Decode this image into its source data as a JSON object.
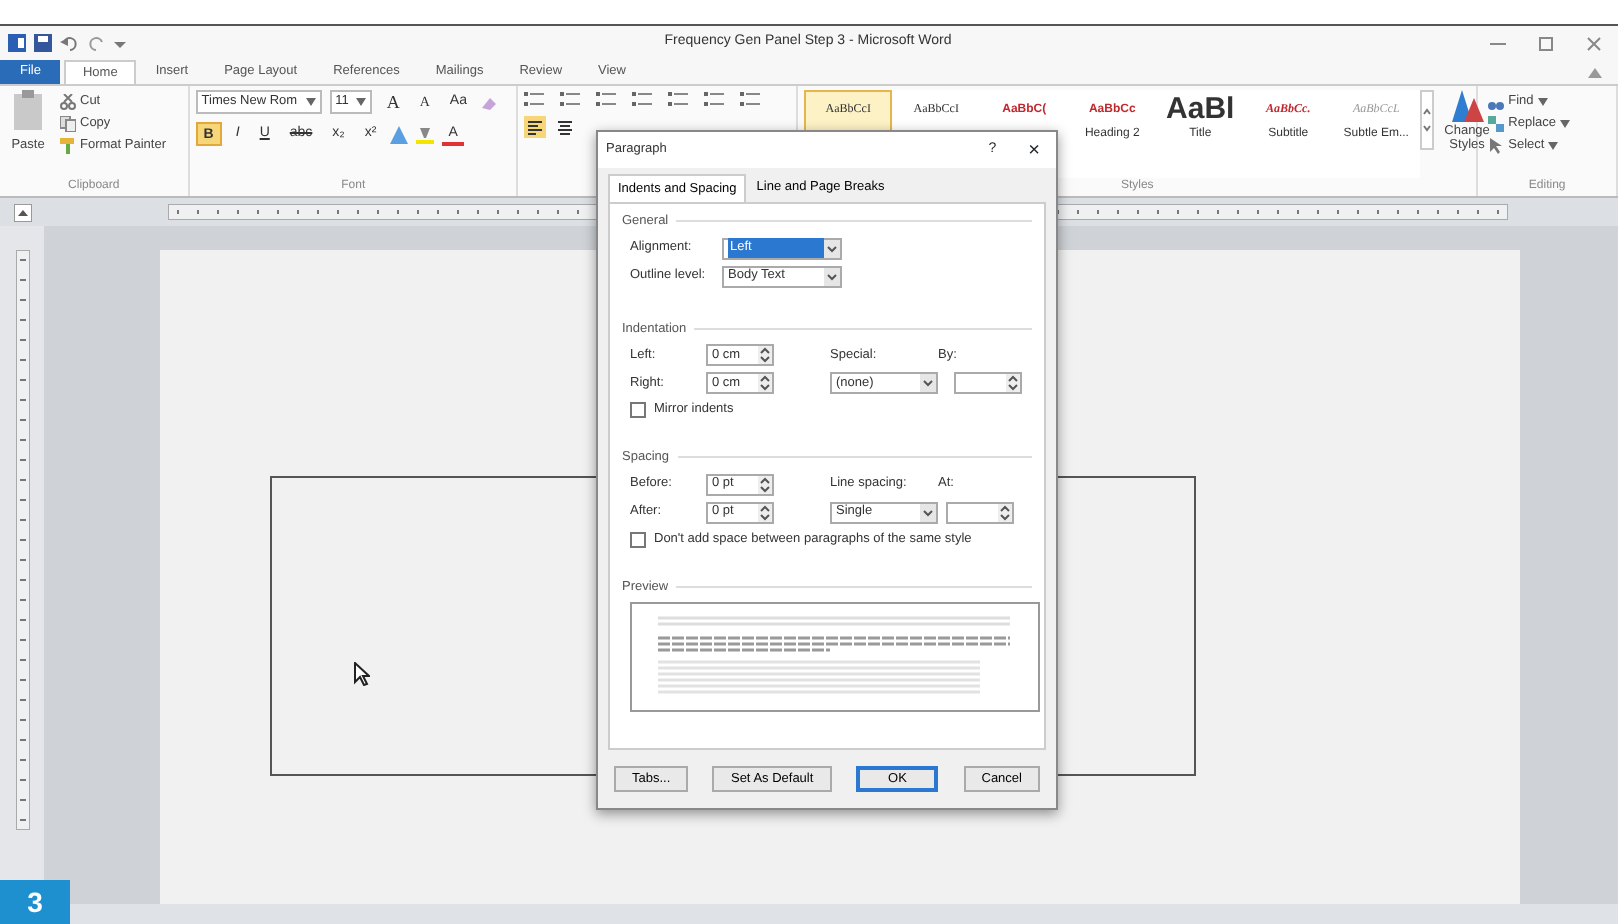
{
  "title_bar": {
    "title": "Frequency Gen Panel Step 3 - Microsoft Word"
  },
  "ribbon_tabs": [
    {
      "label": "File",
      "kind": "file",
      "selected": false
    },
    {
      "label": "Home",
      "kind": "tab",
      "selected": true
    },
    {
      "label": "Insert",
      "kind": "tab",
      "selected": false
    },
    {
      "label": "Page Layout",
      "kind": "tab",
      "selected": false
    },
    {
      "label": "References",
      "kind": "tab",
      "selected": false
    },
    {
      "label": "Mailings",
      "kind": "tab",
      "selected": false
    },
    {
      "label": "Review",
      "kind": "tab",
      "selected": false
    },
    {
      "label": "View",
      "kind": "tab",
      "selected": false
    }
  ],
  "clipboard": {
    "paste": "Paste",
    "items": [
      "Cut",
      "Copy",
      "Format Painter"
    ],
    "group_label": "Clipboard"
  },
  "font": {
    "name": "Times New Rom",
    "size": "11",
    "tools": [
      "A",
      "A",
      "Aa"
    ],
    "format_buttons": [
      {
        "label": "B",
        "kind": "bold",
        "selected": true
      },
      {
        "label": "I",
        "kind": "italic",
        "selected": false
      },
      {
        "label": "U",
        "kind": "underline",
        "selected": false
      },
      {
        "label": "abc",
        "kind": "strike",
        "selected": false
      },
      {
        "label": "x₂",
        "kind": "plain",
        "selected": false
      },
      {
        "label": "x²",
        "kind": "plain",
        "selected": false
      },
      {
        "label": "A",
        "kind": "color",
        "selected": false
      }
    ],
    "group_label": "Font"
  },
  "paragraph": {
    "align_left_selected": true
  },
  "styles": {
    "gallery": [
      {
        "sample": "AaBbCcI",
        "kind": "normal",
        "selected": true
      },
      {
        "sample": "AaBbCcI",
        "kind": "normal",
        "selected": false
      },
      {
        "sample": "AaBbC(",
        "kind": "heading",
        "selected": false
      },
      {
        "sample": "AaBbCc",
        "kind": "heading",
        "selected": false,
        "name": "Heading 2"
      },
      {
        "sample": "AaBl",
        "kind": "title",
        "selected": false,
        "name": "Title"
      },
      {
        "sample": "AaBbCc.",
        "kind": "subtitle",
        "selected": false,
        "name": "Subtitle"
      },
      {
        "sample": "AaBbCcL",
        "kind": "subtle",
        "selected": false,
        "name": "Subtle Em..."
      }
    ],
    "change_styles": "Change Styles",
    "group_label": "Styles"
  },
  "editing": {
    "items": [
      "Find",
      "Replace",
      "Select"
    ],
    "group_label": "Editing"
  },
  "dialog": {
    "title": "Paragraph",
    "help": "?",
    "close": "×",
    "tabs": [
      {
        "label": "Indents and Spacing",
        "selected": true
      },
      {
        "label": "Line and Page Breaks",
        "selected": false
      }
    ],
    "general": {
      "heading": "General",
      "alignment": {
        "label": "Alignment:",
        "value": "Left",
        "highlighted": true
      },
      "outline": {
        "label": "Outline level:",
        "value": "Body Text",
        "highlighted": false
      }
    },
    "indentation": {
      "heading": "Indentation",
      "left": {
        "label": "Left:",
        "value": "0 cm"
      },
      "right": {
        "label": "Right:",
        "value": "0 cm"
      },
      "special": {
        "label": "Special:",
        "value": "(none)"
      },
      "by": {
        "label": "By:"
      },
      "mirror": {
        "label": "Mirror indents",
        "checked": false
      }
    },
    "spacing": {
      "heading": "Spacing",
      "before": {
        "label": "Before:",
        "value": "0 pt"
      },
      "after": {
        "label": "After:",
        "value": "0 pt"
      },
      "line": {
        "label": "Line spacing:",
        "value": "Single"
      },
      "at": {
        "label": "At:"
      },
      "no_space": {
        "label": "Don't add space between paragraphs of the same style",
        "checked": false
      }
    },
    "preview": {
      "heading": "Preview"
    },
    "buttons": [
      {
        "label": "Tabs...",
        "default": false
      },
      {
        "label": "Set As Default",
        "default": false
      },
      {
        "label": "OK",
        "default": true
      },
      {
        "label": "Cancel",
        "default": false
      }
    ]
  },
  "step_badge": "3"
}
